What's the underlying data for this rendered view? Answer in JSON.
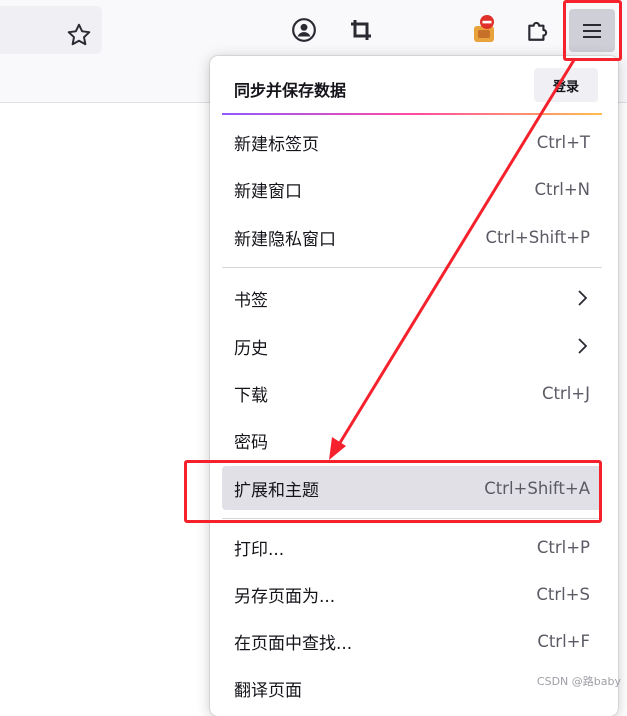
{
  "toolbar": {
    "icons": [
      "star-icon",
      "account-icon",
      "crop-icon",
      "extension-badge-icon",
      "puzzle-icon",
      "hamburger-menu-icon"
    ]
  },
  "menu": {
    "sync_title": "同步并保存数据",
    "signin_label": "登录",
    "items": [
      {
        "label": "新建标签页",
        "shortcut": "Ctrl+T"
      },
      {
        "label": "新建窗口",
        "shortcut": "Ctrl+N"
      },
      {
        "label": "新建隐私窗口",
        "shortcut": "Ctrl+Shift+P"
      },
      {
        "label": "书签",
        "shortcut": ""
      },
      {
        "label": "历史",
        "shortcut": ""
      },
      {
        "label": "下载",
        "shortcut": "Ctrl+J"
      },
      {
        "label": "密码",
        "shortcut": ""
      },
      {
        "label": "扩展和主题",
        "shortcut": "Ctrl+Shift+A"
      },
      {
        "label": "打印...",
        "shortcut": "Ctrl+P"
      },
      {
        "label": "另存页面为...",
        "shortcut": "Ctrl+S"
      },
      {
        "label": "在页面中查找...",
        "shortcut": "Ctrl+F"
      },
      {
        "label": "翻译页面",
        "shortcut": ""
      }
    ]
  },
  "watermark": "CSDN @路baby",
  "colors": {
    "annotation": "#f5222d",
    "hover": "#e0e0e6"
  }
}
